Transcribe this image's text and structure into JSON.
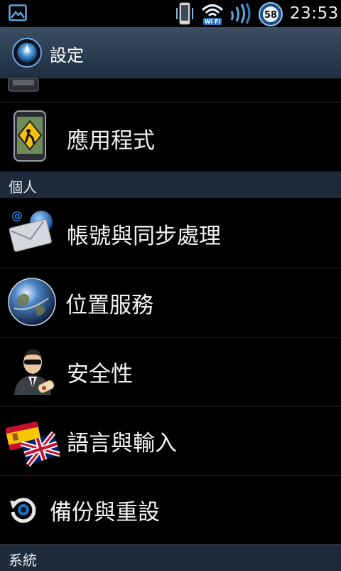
{
  "status_bar": {
    "time": "23:53",
    "battery_level": "58",
    "wifi_label": "Wi Fi",
    "icons": [
      "gallery-notification-icon",
      "phone-vibrate-icon",
      "wifi-icon",
      "signal-icon",
      "battery-icon"
    ]
  },
  "action_bar": {
    "title": "設定",
    "icon": "settings-app-icon"
  },
  "list": {
    "partial_item": {
      "icon": "storage-icon"
    },
    "apps": {
      "label": "應用程式",
      "icon": "applications-icon"
    },
    "section_personal": "個人",
    "accounts": {
      "label": "帳號與同步處理",
      "icon": "accounts-sync-icon"
    },
    "location": {
      "label": "位置服務",
      "icon": "location-globe-icon"
    },
    "security": {
      "label": "安全性",
      "icon": "security-icon"
    },
    "language": {
      "label": "語言與輸入",
      "icon": "language-flags-icon"
    },
    "backup": {
      "label": "備份與重設",
      "icon": "backup-reset-icon"
    },
    "section_system": "系統"
  },
  "colors": {
    "action_bar": "#2a3c50",
    "section_header": "#1d2b3b",
    "background": "#000000",
    "text": "#f2f2f2"
  }
}
